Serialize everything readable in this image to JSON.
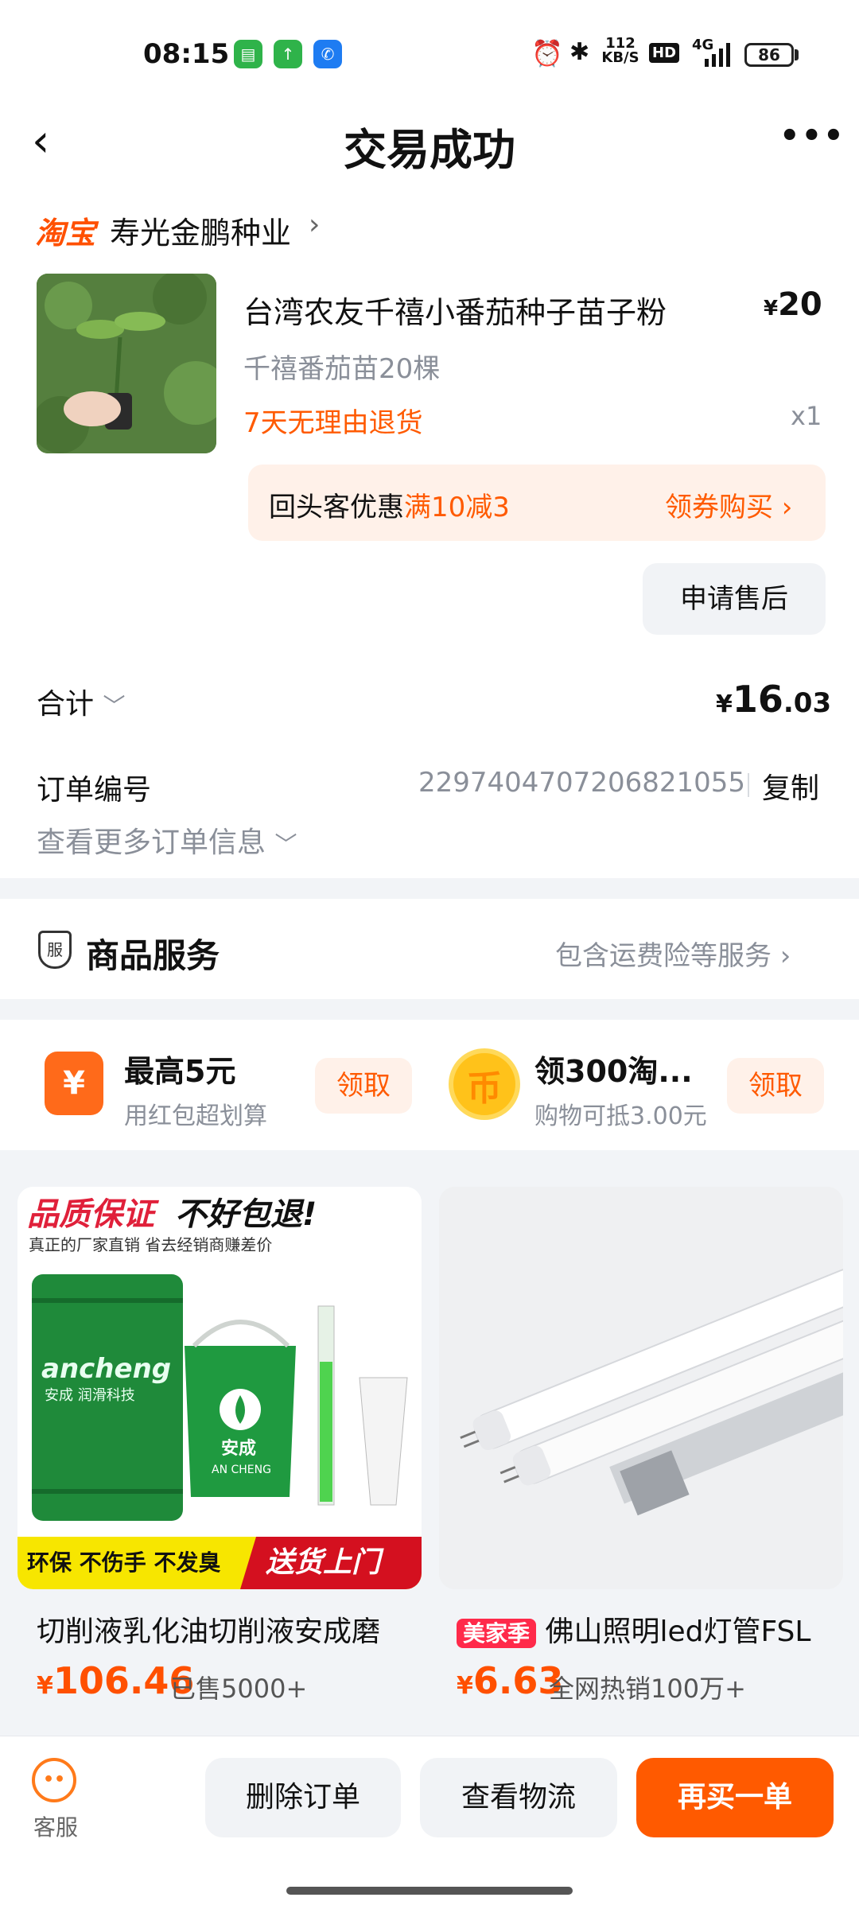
{
  "status_bar": {
    "time": "08:15",
    "net_speed": "112 KB/S",
    "hd": "HD",
    "signal": "4G",
    "battery": "86",
    "icons": [
      "alarm-icon",
      "bluetooth-icon",
      "signal-icon"
    ]
  },
  "header": {
    "title": "交易成功",
    "back_icon": "‹",
    "more_icon": "•••"
  },
  "shop": {
    "platform": "淘宝",
    "name": "寿光金鹏种业",
    "chevron": "›"
  },
  "product": {
    "title": "台湾农友千禧小番茄种子苗子粉",
    "currency": "¥",
    "price": "20",
    "variant": "千禧番茄苗20棵",
    "return_policy": "7天无理由退货",
    "quantity": "x1"
  },
  "coupon": {
    "label": "回头客优惠",
    "highlight": "满10减3",
    "action": "领券购买 ›"
  },
  "after_sale_button": "申请售后",
  "total": {
    "label": "合计",
    "currency": "¥",
    "integer": "16",
    "decimal": ".03"
  },
  "order": {
    "number_label": "订单编号",
    "number": "2297404707206821055",
    "copy": "复制",
    "more_info": "查看更多订单信息"
  },
  "service": {
    "icon_text": "服",
    "title": "商品服务",
    "description": "包含运费险等服务 ›"
  },
  "promos": [
    {
      "icon": "¥",
      "title": "最高5元",
      "subtitle": "用红包超划算",
      "button": "领取"
    },
    {
      "icon": "币",
      "title": "领300淘...",
      "subtitle": "购物可抵3.00元",
      "button": "领取"
    }
  ],
  "recommendations": [
    {
      "banner_headline_1": "品质保证",
      "banner_headline_2": "不好包退!",
      "banner_subline": "真正的厂家直销  省去经销商赚差价",
      "brand": "ancheng",
      "brand_cn": "安成",
      "brand_en": "AN CHENG",
      "brand_sub": "安成 润滑科技",
      "strip_left": "环保 不伤手 不发臭",
      "strip_right": "送货上门",
      "title": "切削液乳化油切削液安成磨",
      "currency": "¥",
      "price": "106.46",
      "sold": "已售5000+"
    },
    {
      "badge": "美家季",
      "title": "佛山照明led灯管FSL",
      "currency": "¥",
      "price": "6.63",
      "sold": "全网热销100万+"
    }
  ],
  "bottom_bar": {
    "customer_service": "客服",
    "delete_order": "删除订单",
    "view_logistics": "查看物流",
    "buy_again": "再买一单"
  },
  "colors": {
    "accent": "#ff5000",
    "coupon_bg": "#fff1e9",
    "gray_button": "#f1f3f6",
    "muted_text": "#8a8f99"
  }
}
